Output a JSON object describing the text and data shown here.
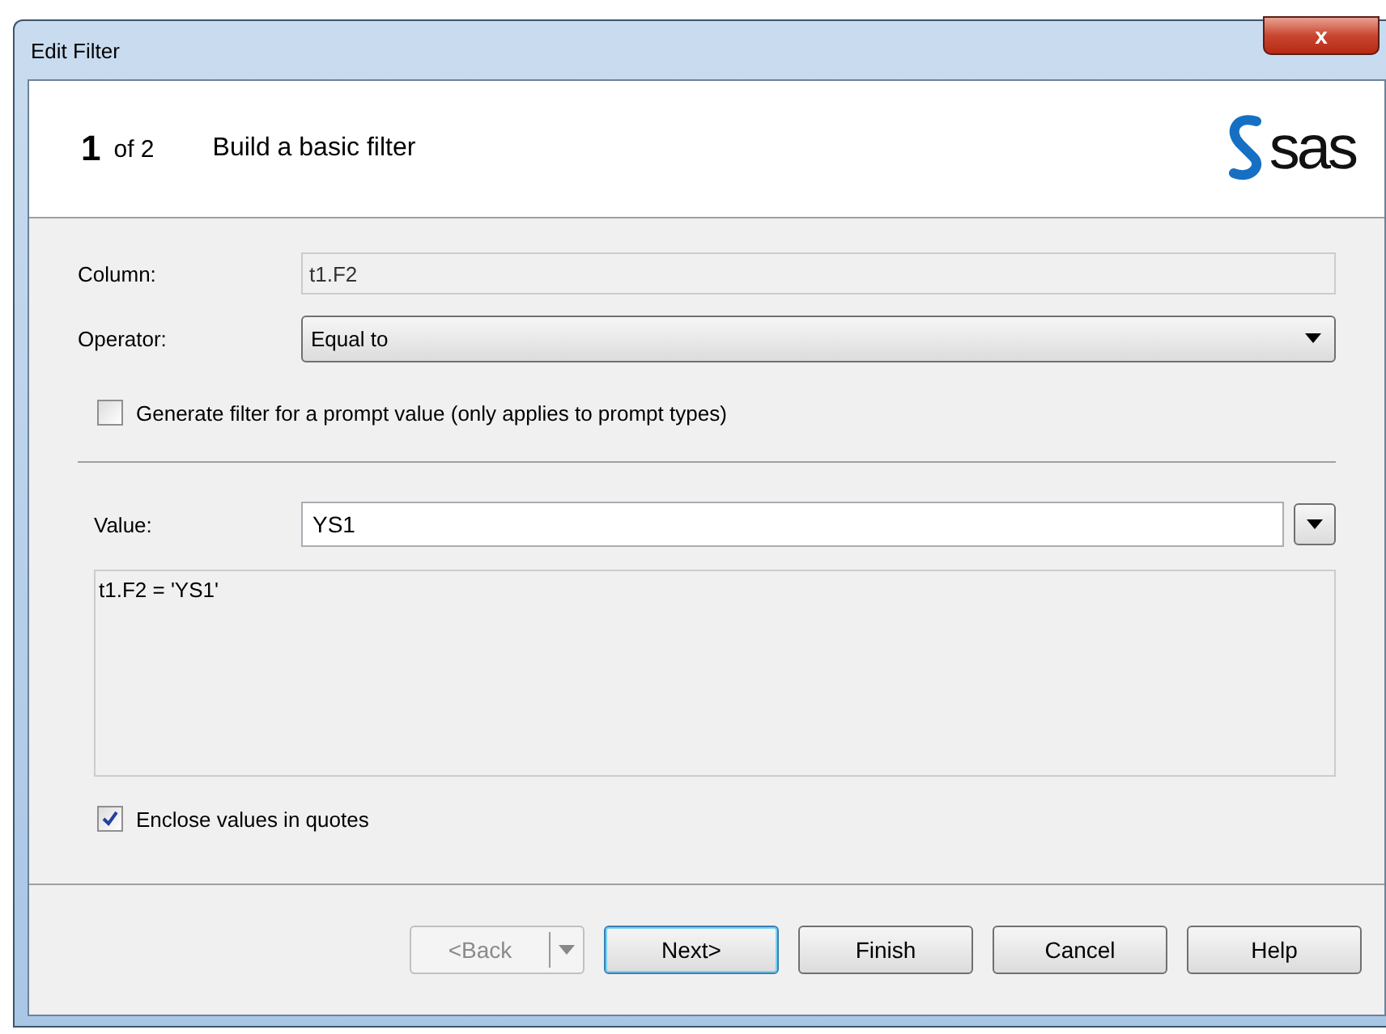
{
  "window": {
    "title": "Edit Filter",
    "close": "x"
  },
  "header": {
    "step": "1",
    "of": "of 2",
    "title": "Build a basic filter",
    "logo": "sas"
  },
  "column": {
    "label": "Column:",
    "value": "t1.F2"
  },
  "operator": {
    "label": "Operator:",
    "value": "Equal to"
  },
  "prompt_checkbox": {
    "label": "Generate filter for a prompt value (only applies to prompt types)",
    "checked": false
  },
  "value": {
    "label": "Value:",
    "value": "YS1"
  },
  "expression": "t1.F2 = 'YS1'",
  "quotes_checkbox": {
    "label": "Enclose values in quotes",
    "checked": true
  },
  "buttons": [
    {
      "label": "<Back",
      "disabled": true,
      "default": false,
      "split": true
    },
    {
      "label": "Next>",
      "disabled": false,
      "default": true,
      "split": false
    },
    {
      "label": "Finish",
      "disabled": false,
      "default": false,
      "split": false
    },
    {
      "label": "Cancel",
      "disabled": false,
      "default": false,
      "split": false
    },
    {
      "label": "Help",
      "disabled": false,
      "default": false,
      "split": false
    }
  ]
}
